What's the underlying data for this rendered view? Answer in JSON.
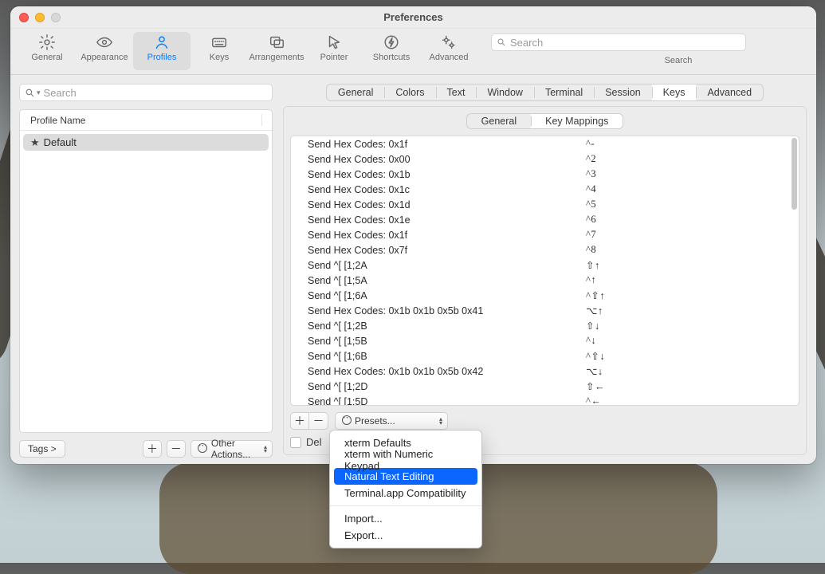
{
  "window": {
    "title": "Preferences"
  },
  "toolbar": {
    "items": [
      {
        "label": "General"
      },
      {
        "label": "Appearance"
      },
      {
        "label": "Profiles"
      },
      {
        "label": "Keys"
      },
      {
        "label": "Arrangements"
      },
      {
        "label": "Pointer"
      },
      {
        "label": "Shortcuts"
      },
      {
        "label": "Advanced"
      }
    ],
    "selected": "Profiles",
    "search_placeholder": "Search",
    "search_label": "Search"
  },
  "sidebar": {
    "search_placeholder": "Search",
    "header": "Profile Name",
    "profiles": [
      {
        "name": "Default",
        "starred": true,
        "selected": true
      }
    ],
    "tags_button": "Tags >",
    "other_actions": "Other Actions..."
  },
  "profile_tabs": {
    "items": [
      "General",
      "Colors",
      "Text",
      "Window",
      "Terminal",
      "Session",
      "Keys",
      "Advanced"
    ],
    "selected": "Keys"
  },
  "keys_subtabs": {
    "items": [
      "General",
      "Key Mappings"
    ],
    "selected": "Key Mappings"
  },
  "key_mappings": [
    {
      "action": "Send Hex Codes: 0x1f",
      "shortcut": "^-"
    },
    {
      "action": "Send Hex Codes: 0x00",
      "shortcut": "^2"
    },
    {
      "action": "Send Hex Codes: 0x1b",
      "shortcut": "^3"
    },
    {
      "action": "Send Hex Codes: 0x1c",
      "shortcut": "^4"
    },
    {
      "action": "Send Hex Codes: 0x1d",
      "shortcut": "^5"
    },
    {
      "action": "Send Hex Codes: 0x1e",
      "shortcut": "^6"
    },
    {
      "action": "Send Hex Codes: 0x1f",
      "shortcut": "^7"
    },
    {
      "action": "Send Hex Codes: 0x7f",
      "shortcut": "^8"
    },
    {
      "action": "Send ^[ [1;2A",
      "shortcut": "⇧↑"
    },
    {
      "action": "Send ^[ [1;5A",
      "shortcut": "^↑"
    },
    {
      "action": "Send ^[ [1;6A",
      "shortcut": "^⇧↑"
    },
    {
      "action": "Send Hex Codes: 0x1b 0x1b 0x5b 0x41",
      "shortcut": "⌥↑"
    },
    {
      "action": "Send ^[ [1;2B",
      "shortcut": "⇧↓"
    },
    {
      "action": "Send ^[ [1;5B",
      "shortcut": "^↓"
    },
    {
      "action": "Send ^[ [1;6B",
      "shortcut": "^⇧↓"
    },
    {
      "action": "Send Hex Codes: 0x1b 0x1b 0x5b 0x42",
      "shortcut": "⌥↓"
    },
    {
      "action": "Send ^[ [1;2D",
      "shortcut": "⇧←"
    },
    {
      "action": "Send ^[ [1;5D",
      "shortcut": "^←"
    }
  ],
  "presets": {
    "button_label": "Presets...",
    "menu": [
      "xterm Defaults",
      "xterm with Numeric Keypad",
      "Natural Text Editing",
      "Terminal.app Compatibility",
      "---",
      "Import...",
      "Export..."
    ],
    "highlighted": "Natural Text Editing"
  },
  "delete_checkbox_label": "Del"
}
